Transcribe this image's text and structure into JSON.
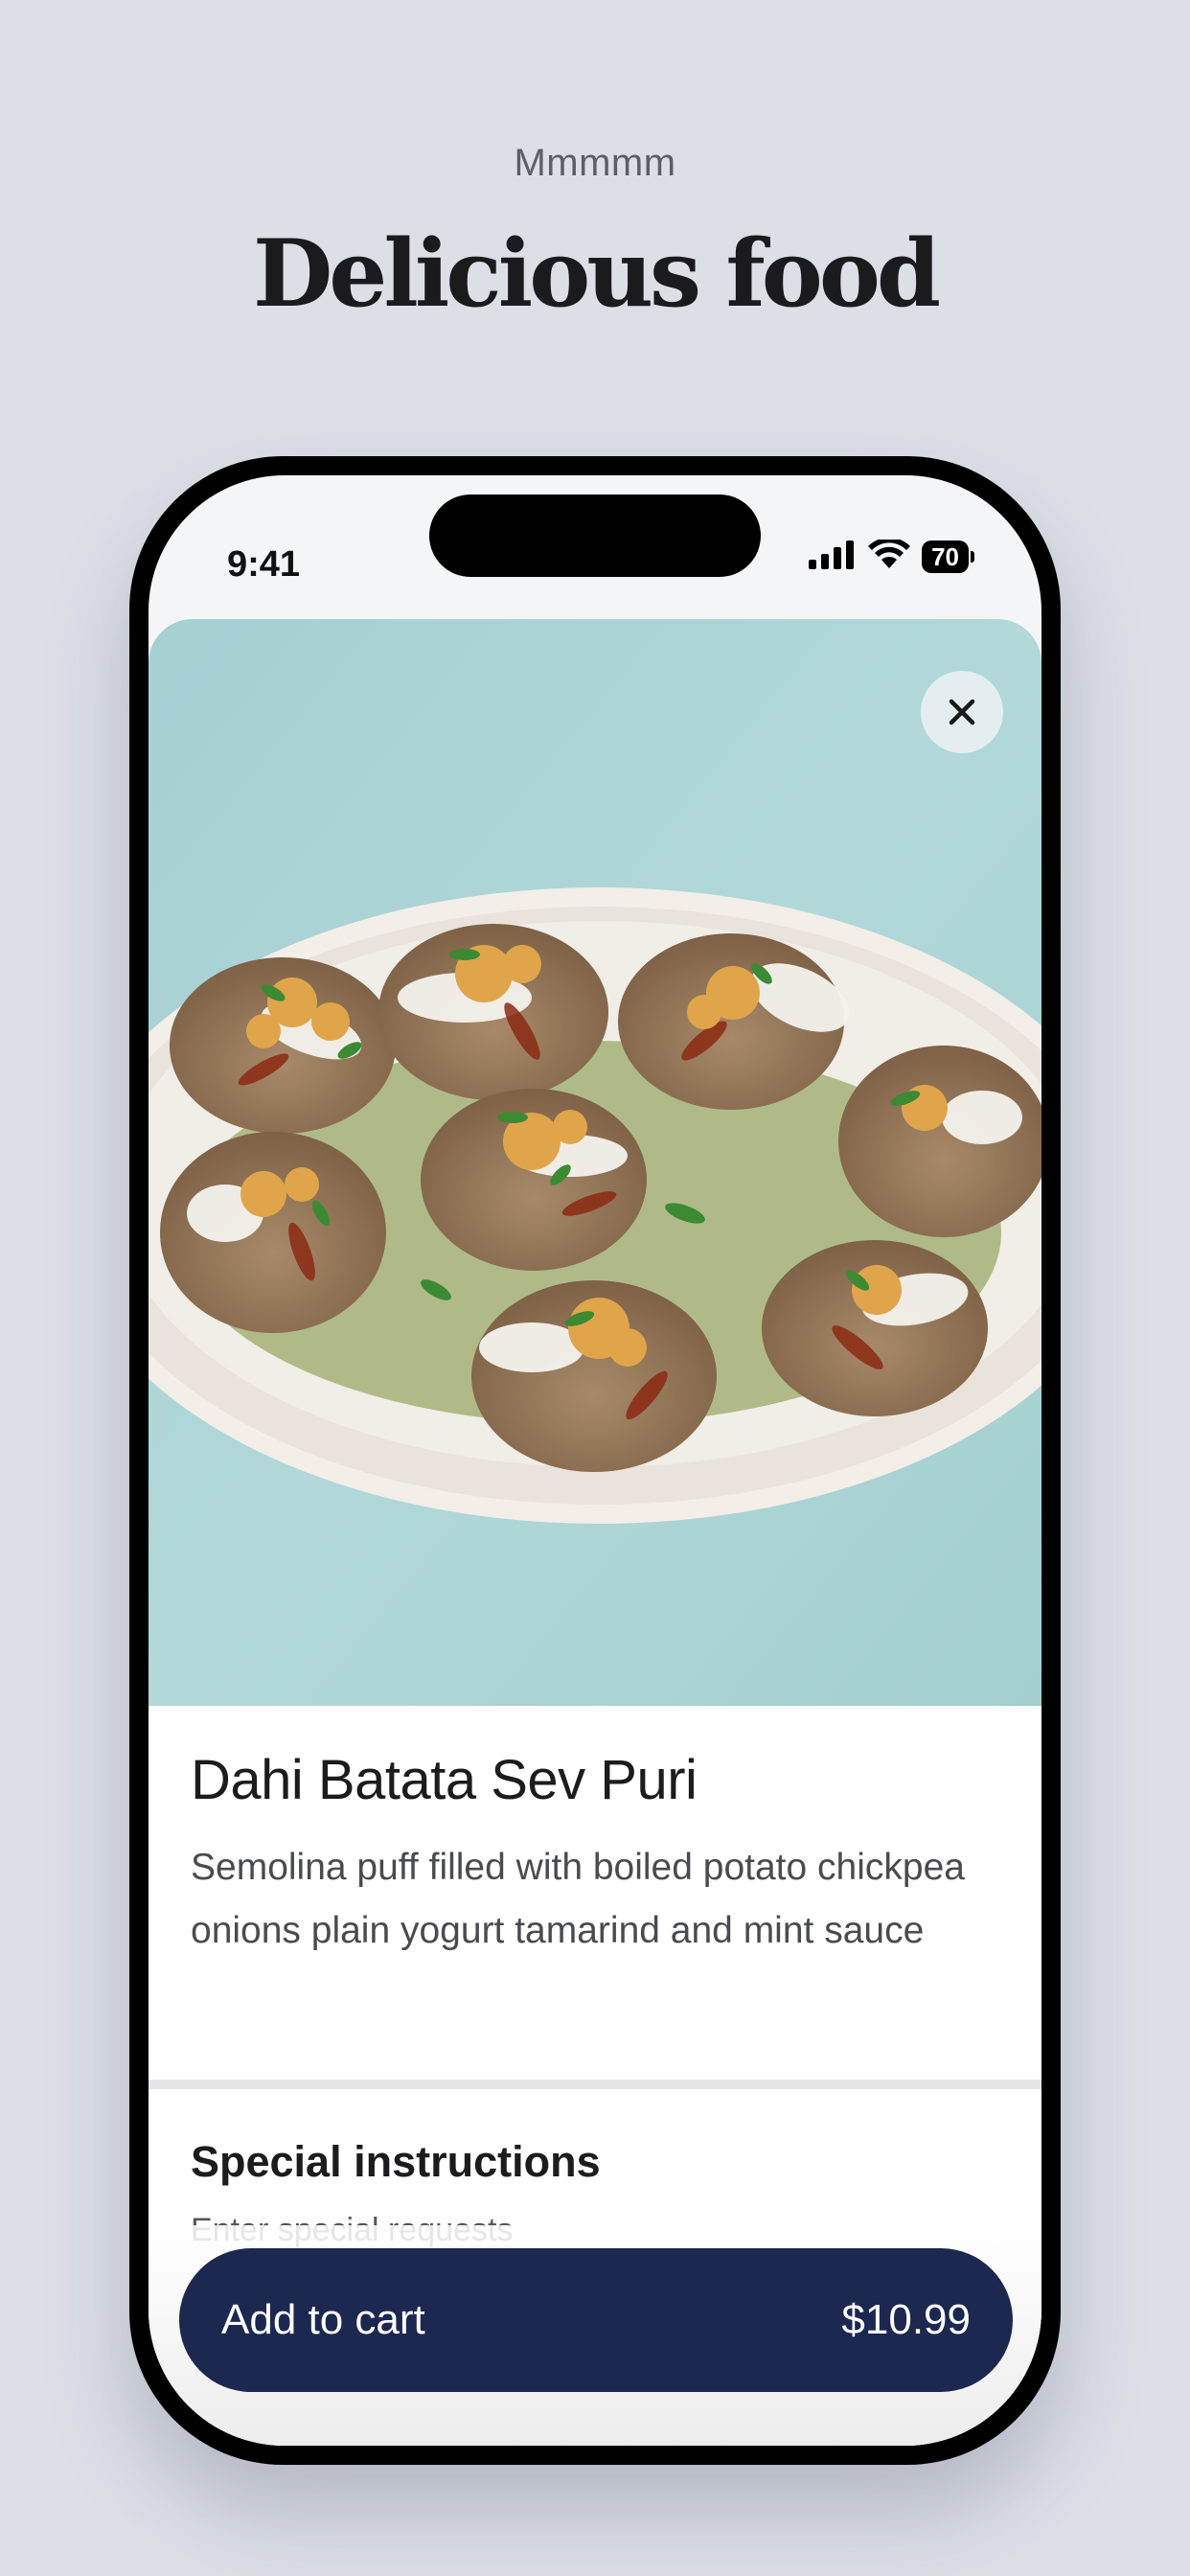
{
  "promo": {
    "eyebrow": "Mmmmm",
    "headline": "Delicious food"
  },
  "status_bar": {
    "time": "9:41",
    "battery": "70",
    "icons": [
      "signal-icon",
      "wifi-icon",
      "battery-icon"
    ]
  },
  "item": {
    "image_icon": "food-photo",
    "close_icon": "close-icon",
    "title": "Dahi Batata Sev Puri",
    "description": "Semolina puff filled with boiled potato chickpea onions plain yogurt tamarind and mint sauce"
  },
  "instructions": {
    "title": "Special instructions",
    "placeholder": "Enter special requests",
    "value": ""
  },
  "cart": {
    "label": "Add to cart",
    "price": "$10.99"
  },
  "colors": {
    "page_background": "#dcdfe6",
    "button": "#1d2850",
    "photo_background": "#a9d3d5"
  }
}
